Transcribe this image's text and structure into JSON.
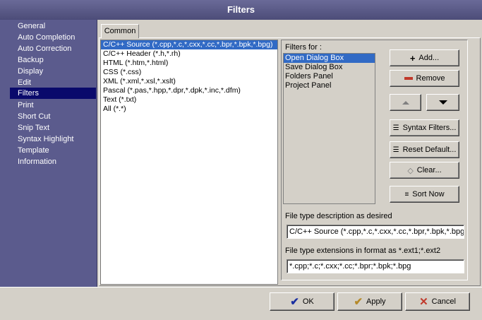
{
  "window": {
    "title": "Filters"
  },
  "sidebar": {
    "items": [
      {
        "label": "General"
      },
      {
        "label": "Auto Completion"
      },
      {
        "label": "Auto Correction"
      },
      {
        "label": "Backup"
      },
      {
        "label": "Display"
      },
      {
        "label": "Edit"
      },
      {
        "label": "Filters"
      },
      {
        "label": "Print"
      },
      {
        "label": "Short Cut"
      },
      {
        "label": "Snip Text"
      },
      {
        "label": "Syntax Highlight"
      },
      {
        "label": "Template"
      },
      {
        "label": "Information"
      }
    ],
    "selected": "Filters"
  },
  "tabs": [
    {
      "label": "Common"
    }
  ],
  "file_types": [
    "C/C++ Source (*.cpp,*.c,*.cxx,*.cc,*.bpr,*.bpk,*.bpg)",
    "C/C++ Header (*.h,*.rh)",
    "HTML (*.htm,*.html)",
    "CSS (*.css)",
    "XML (*.xml,*.xsl,*.xslt)",
    "Pascal (*.pas,*.hpp,*.dpr,*.dpk,*.inc,*.dfm)",
    "Text (*.txt)",
    "All (*.*)"
  ],
  "filters_for": {
    "label": "Filters for :",
    "items": [
      "Open Dialog Box",
      "Save Dialog Box",
      "Folders Panel",
      "Project Panel"
    ]
  },
  "buttons": {
    "add": "Add...",
    "remove": "Remove",
    "syntax_filters": "Syntax Filters...",
    "reset_default": "Reset Default...",
    "clear": "Clear...",
    "sort_now": "Sort Now"
  },
  "description": {
    "label": "File type description as desired",
    "value": "C/C++ Source (*.cpp,*.c,*.cxx,*.cc,*.bpr,*.bpk,*.bpg)"
  },
  "extensions": {
    "label": "File type extensions in format as *.ext1;*.ext2",
    "value": "*.cpp;*.c;*.cxx;*.cc;*.bpr;*.bpk;*.bpg"
  },
  "dialog": {
    "ok": "OK",
    "apply": "Apply",
    "cancel": "Cancel"
  },
  "colors": {
    "sidebar": "#5b5b8d",
    "selection": "#316ac5",
    "sidebar_selection": "#0a0a6b"
  }
}
